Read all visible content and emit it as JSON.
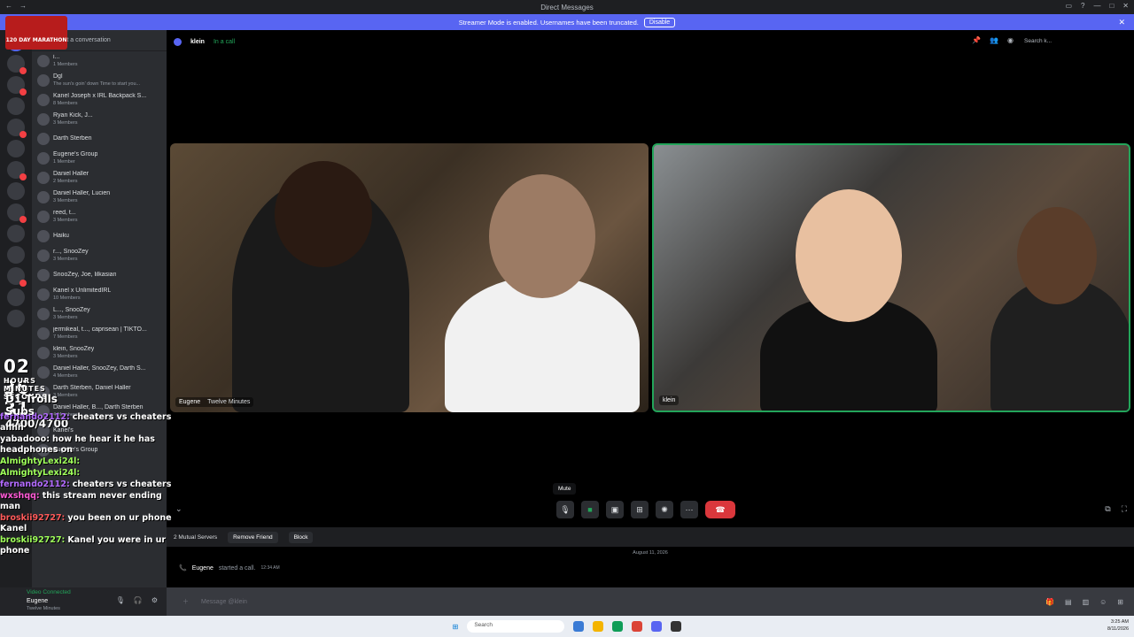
{
  "window": {
    "title": "Direct Messages"
  },
  "streamer_banner": {
    "text": "Streamer Mode is enabled. Usernames have been truncated.",
    "button": "Disable"
  },
  "dm_search_placeholder": "Find or start a conversation",
  "dm_list": [
    {
      "name": "i...",
      "sub": "1 Members"
    },
    {
      "name": "Dgl",
      "sub": "The sun's goin' down Time to start you..."
    },
    {
      "name": "Kanel Joseph x IRL Backpack S...",
      "sub": "8 Members"
    },
    {
      "name": "Ryan Kick, J...",
      "sub": "3 Members"
    },
    {
      "name": "Darth Sterben",
      "sub": ""
    },
    {
      "name": "Eugene's Group",
      "sub": "1 Member"
    },
    {
      "name": "Daniel Haller",
      "sub": "2 Members"
    },
    {
      "name": "Daniel Haller, Lucien",
      "sub": "3 Members"
    },
    {
      "name": "reed, t...",
      "sub": "3 Members"
    },
    {
      "name": "Haiku",
      "sub": ""
    },
    {
      "name": "r..., SnooZey",
      "sub": "3 Members"
    },
    {
      "name": "SnooZey, Joe, lilkasian",
      "sub": ""
    },
    {
      "name": "Kanel x UnlimitedIRL",
      "sub": "10 Members"
    },
    {
      "name": "L..., SnooZey",
      "sub": "3 Members"
    },
    {
      "name": "jermikeal, t..., caprisean | TIKTO...",
      "sub": "7 Members"
    },
    {
      "name": "klein, SnooZey",
      "sub": "3 Members"
    },
    {
      "name": "Daniel Haller, SnooZey, Darth S...",
      "sub": "4 Members"
    },
    {
      "name": "Darth Sterben, Daniel Haller",
      "sub": "3 Members"
    },
    {
      "name": "Daniel Haller, B..., Darth Sterben",
      "sub": "4 Members"
    },
    {
      "name": "Kanel's",
      "sub": ""
    },
    {
      "name": "Eugene's Group",
      "sub": ""
    }
  ],
  "user_panel": {
    "status": "Video Connected",
    "name": "Eugene",
    "sub": "Twelve Minutes"
  },
  "call_header": {
    "name": "klein",
    "status": "In a call",
    "search_placeholder": "Search k..."
  },
  "tiles": [
    {
      "name": "Eugene",
      "activity": "Twelve Minutes"
    },
    {
      "name": "klein",
      "activity": ""
    }
  ],
  "tooltip": "Mute",
  "profile_bar": {
    "mutual": "2 Mutual Servers",
    "remove": "Remove Friend",
    "block": "Block"
  },
  "date_separator": "August 11, 2026",
  "call_message": {
    "who": "Eugene",
    "text": "started a call.",
    "time": "12:34 AM"
  },
  "chat_placeholder": "Message @klein",
  "taskbar": {
    "search": "Search",
    "time": "3:25 AM",
    "date": "8/11/2026"
  },
  "overlay": {
    "marathon": "120 DAY MARATHON",
    "timer": "02  36  31",
    "timer_labels": "HOURS  MINUTES  SECONDS",
    "subs": "D1 Trolls Subs 4700/4700",
    "chat": [
      {
        "user": "fernando2112:",
        "msg": "cheaters vs cheaters ahhh",
        "color": "#b36bff"
      },
      {
        "user": "yabadooo:",
        "msg": "how he hear it he has headphones on",
        "color": "#ffffff"
      },
      {
        "user": "AlmightyLexi24l:",
        "msg": "",
        "color": "#9fff5a"
      },
      {
        "user": "AlmightyLexi24l:",
        "msg": "",
        "color": "#9fff5a"
      },
      {
        "user": "fernando2112:",
        "msg": "cheaters vs cheaters",
        "color": "#b36bff"
      },
      {
        "user": "wxshqq:",
        "msg": "this stream never ending man",
        "color": "#ff5ad6"
      },
      {
        "user": "broskii92727:",
        "msg": "you been on ur phone Kanel",
        "color": "#ff5a5a"
      },
      {
        "user": "broskii92727:",
        "msg": "Kanel you were in ur phone",
        "color": "#9fff5a"
      }
    ]
  }
}
